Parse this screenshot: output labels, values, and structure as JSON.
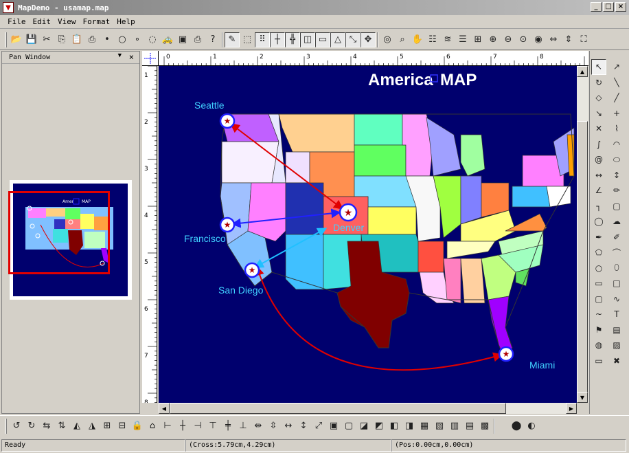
{
  "window": {
    "title": "MapDemo - usamap.map",
    "app_icon": "map-app-icon",
    "controls": [
      "_",
      "□",
      "×"
    ]
  },
  "menu": {
    "items": [
      "File",
      "Edit",
      "View",
      "Format",
      "Help"
    ]
  },
  "toolbar": {
    "icons": [
      "open-icon",
      "save-icon",
      "cut-icon",
      "copy-icon",
      "paste-icon",
      "print-icon",
      "node-dot-icon",
      "node-ring-icon",
      "node-small-icon",
      "node-hollow-icon",
      "car-icon",
      "monitor-icon",
      "printer-icon",
      "help-icon",
      "edit-mode-icon",
      "select-icon",
      "grid-icon",
      "ruler-icon",
      "guides-icon",
      "layout-icon",
      "rectangle-icon",
      "triangle-icon",
      "resize-icon",
      "snap-icon",
      "focus-icon",
      "zoom-icon",
      "hand-icon",
      "properties-icon",
      "layers-icon",
      "align-icon",
      "center-icon",
      "zoom-in-icon",
      "zoom-out-icon",
      "zoom-fit-icon",
      "zoom-100-icon",
      "fit-width-icon",
      "fit-height-icon",
      "fit-page-icon"
    ]
  },
  "pan_window": {
    "title": "Pan Window",
    "close": "×",
    "dropdown": "▼"
  },
  "map": {
    "title": "America",
    "title2": "MAP",
    "cities": [
      {
        "name": "Seattle"
      },
      {
        "name": "Francisco"
      },
      {
        "name": "San Diego"
      },
      {
        "name": "Denver"
      },
      {
        "name": "Miami"
      }
    ],
    "colors": {
      "background": "#00006e",
      "red_link": "#e00000",
      "blue_link": "#2020ff",
      "cyan_link": "#20c0ff",
      "label": "#40d0ff"
    }
  },
  "ruler": {
    "h_numbers": [
      "0",
      "1",
      "2",
      "3",
      "4",
      "5",
      "6",
      "7",
      "8"
    ],
    "v_numbers": [
      "1",
      "2",
      "3",
      "4",
      "5",
      "6",
      "7",
      "8"
    ]
  },
  "palette": {
    "icons": [
      "pointer-icon",
      "add-point-icon",
      "rotate-icon",
      "link-icon",
      "reshape-icon",
      "line-icon",
      "arrow-icon",
      "plus-icon",
      "cross-icon",
      "polyline-icon",
      "curve-icon",
      "arc-icon",
      "spiral-icon",
      "ellipse-arc-icon",
      "width-icon",
      "height-icon",
      "angle-icon",
      "pencil-icon",
      "connector-icon",
      "callout-icon",
      "bubble-icon",
      "cloud-icon",
      "pen-icon",
      "brush-icon",
      "polygon-icon",
      "freeform-icon",
      "circle-icon",
      "ellipse-icon",
      "rectangle-icon",
      "square-icon",
      "rounded-rect-icon",
      "wave-icon",
      "spline-icon",
      "text-icon",
      "flag-icon",
      "chart-icon",
      "globe-icon",
      "image-icon",
      "window-icon",
      "delete-icon"
    ]
  },
  "bottom_toolbar": {
    "icons": [
      "rotate-left-icon",
      "rotate-right-icon",
      "flip-h-icon",
      "flip-v-icon",
      "mirror-icon",
      "mirror-v-icon",
      "group-icon",
      "ungroup-icon",
      "lock-icon",
      "unlock-icon",
      "align-left-icon",
      "align-center-icon",
      "align-right-icon",
      "align-top-icon",
      "align-middle-icon",
      "align-bottom-icon",
      "space-h-icon",
      "space-v-icon",
      "same-width-icon",
      "same-height-icon",
      "same-size-icon",
      "bring-front-icon",
      "send-back-icon",
      "forward-icon",
      "backward-icon",
      "order-1-icon",
      "order-2-icon",
      "order-3-icon",
      "order-4-icon",
      "order-5-icon",
      "order-6-icon",
      "order-7-icon",
      "shape-a-icon",
      "shape-b-icon"
    ]
  },
  "status": {
    "ready": "Ready",
    "cross": "(Cross:5.79cm,4.29cm)",
    "pos": "(Pos:0.00cm,0.00cm)"
  }
}
